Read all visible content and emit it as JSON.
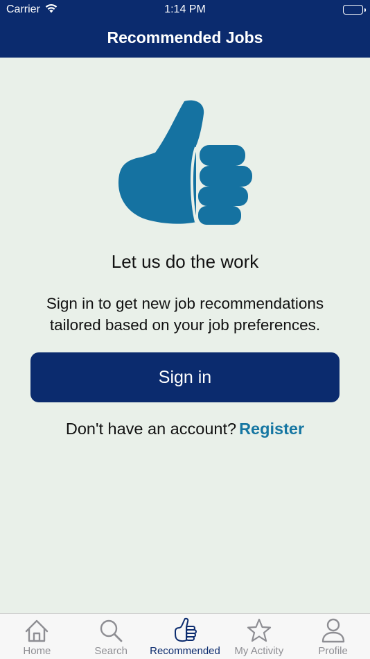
{
  "status_bar": {
    "carrier": "Carrier",
    "time": "1:14 PM"
  },
  "header": {
    "title": "Recommended Jobs"
  },
  "main": {
    "icon": "thumbs-up-icon",
    "heading": "Let us do the work",
    "description": "Sign in to get new job recommendations tailored based on your job preferences.",
    "sign_in_label": "Sign in",
    "no_account_text": "Don't have an account?",
    "register_label": "Register"
  },
  "tabbar": {
    "items": [
      {
        "label": "Home",
        "icon": "home-icon",
        "active": false
      },
      {
        "label": "Search",
        "icon": "search-icon",
        "active": false
      },
      {
        "label": "Recommended",
        "icon": "thumbs-up-icon",
        "active": true
      },
      {
        "label": "My Activity",
        "icon": "star-icon",
        "active": false
      },
      {
        "label": "Profile",
        "icon": "person-icon",
        "active": false
      }
    ]
  },
  "colors": {
    "brand_navy": "#0b2b6e",
    "accent_blue": "#1576a2",
    "background": "#e9f0e9",
    "inactive_tab": "#8e8e93"
  }
}
